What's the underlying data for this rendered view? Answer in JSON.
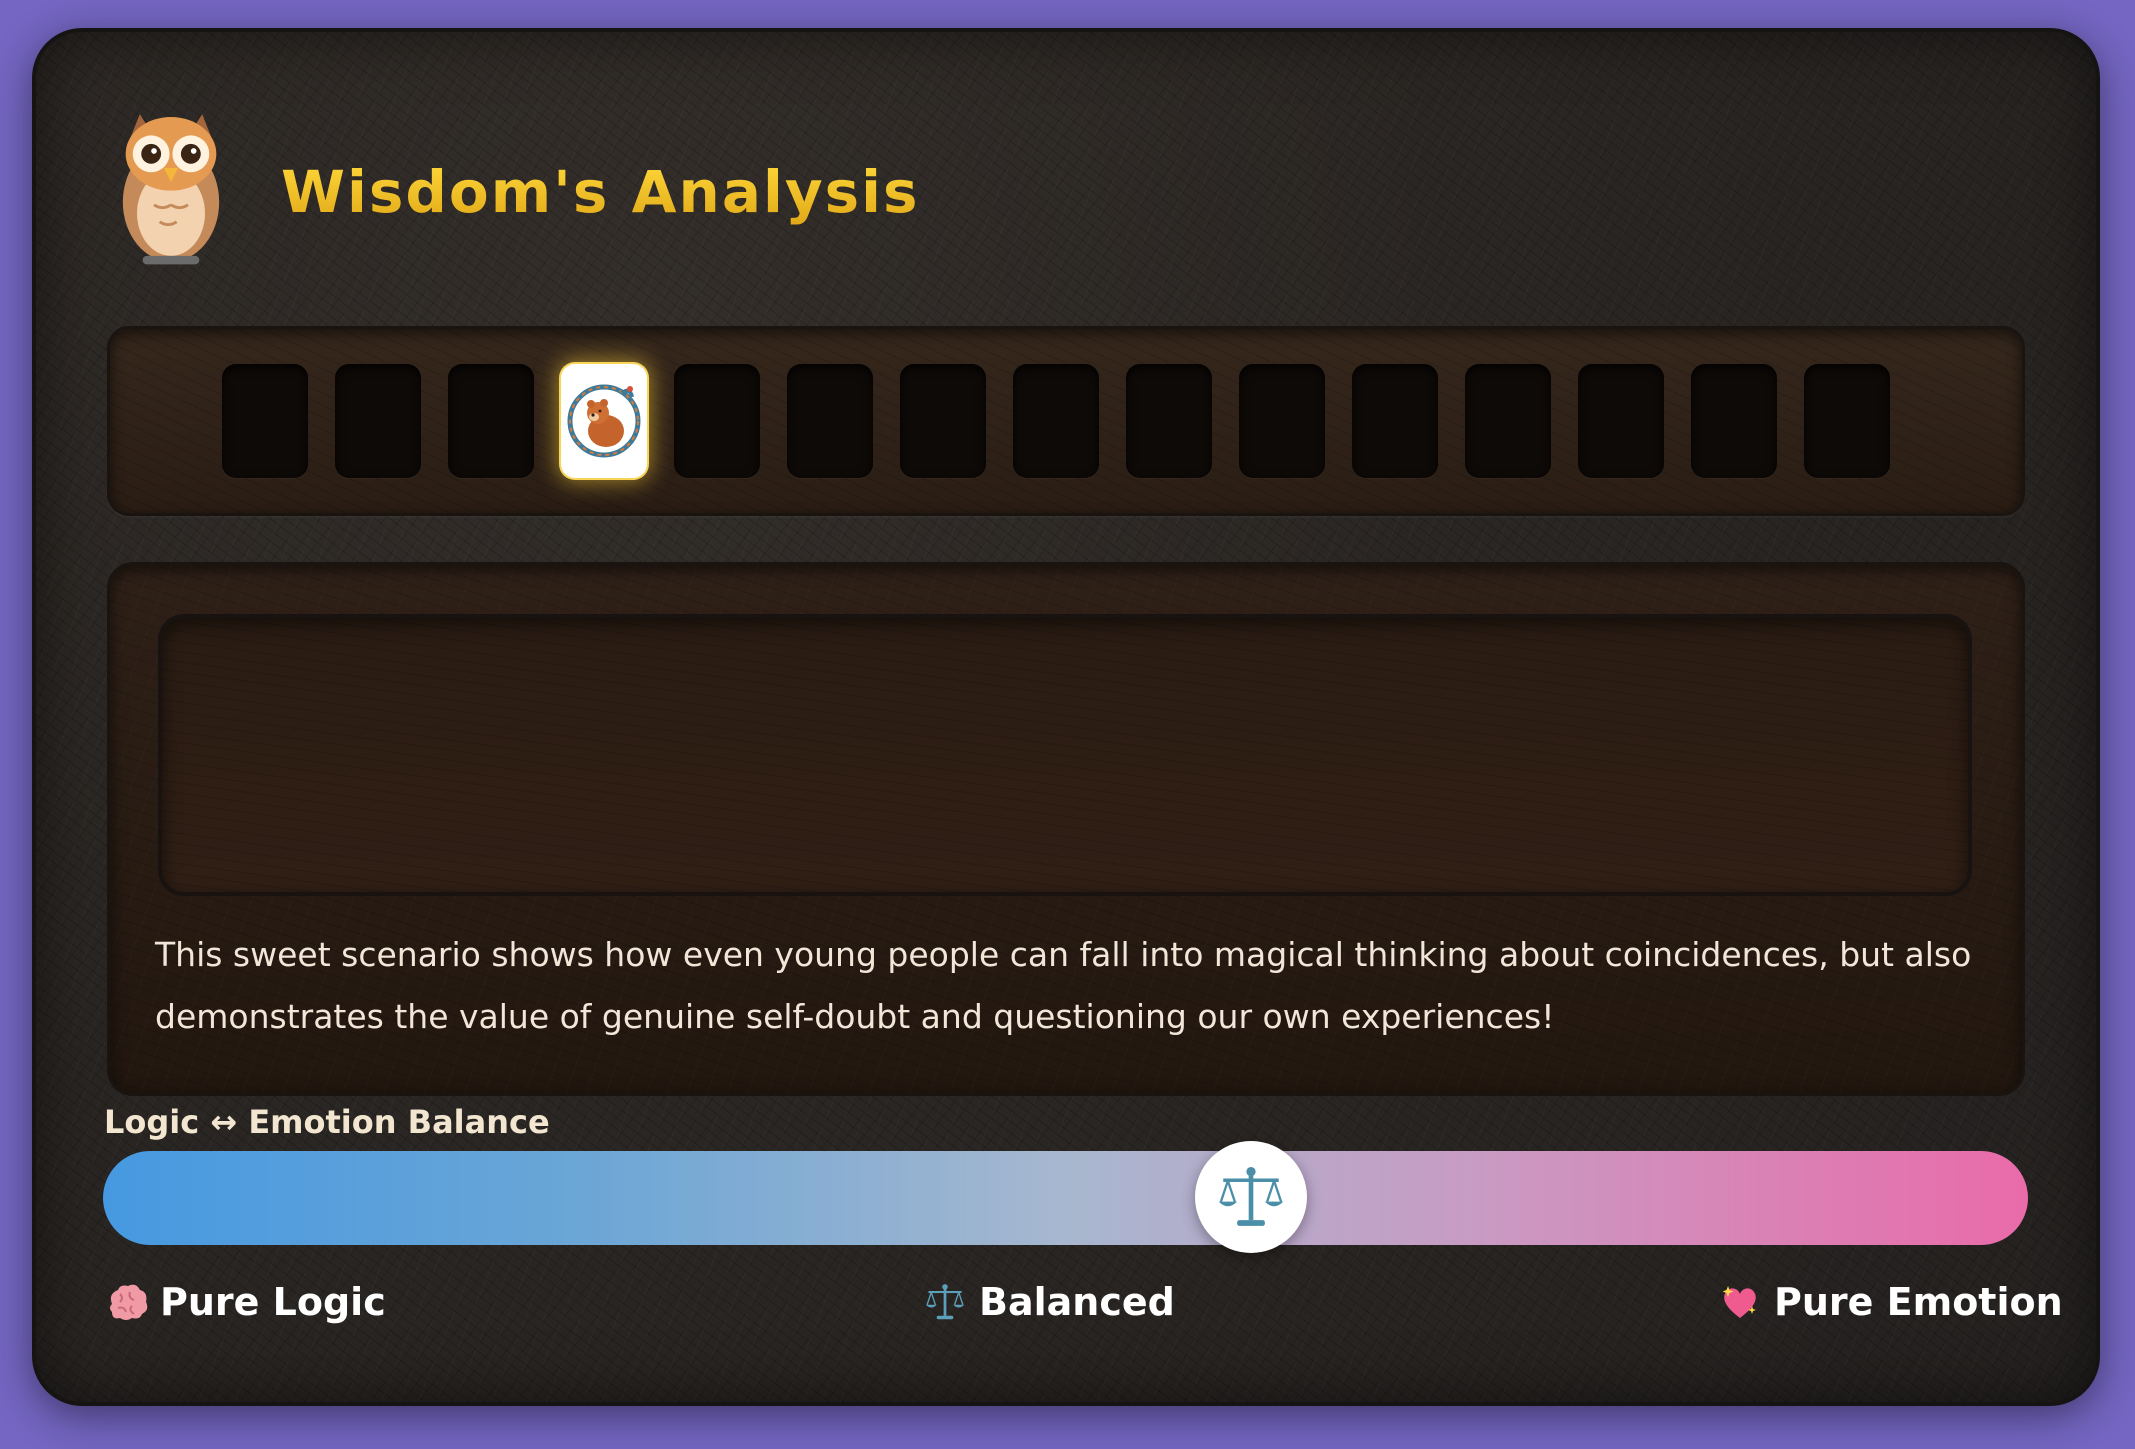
{
  "panel": {
    "title": "Wisdom's Analysis",
    "icon": "owl-icon"
  },
  "cards": {
    "total_slots": 15,
    "active_index": 3,
    "active_card_icon": "bear-snake-card-icon"
  },
  "analysis": {
    "text": "This sweet scenario shows how even young people can fall into magical thinking about coincidences, but also demonstrates the value of genuine self-doubt and questioning our own experiences!"
  },
  "balance": {
    "label": "Logic ↔ Emotion Balance",
    "value_fraction": 0.6,
    "thumb_icon": "scales-icon",
    "left_label": "Pure Logic",
    "left_icon": "brain-icon",
    "center_label": "Balanced",
    "center_icon": "scales-icon",
    "right_label": "Pure Emotion",
    "right_icon": "sparkling-heart-icon"
  },
  "colors": {
    "title_gold": "#f2c21f",
    "logic_blue": "#4699e1",
    "emotion_pink": "#e96ba9",
    "background": "#7466c2"
  }
}
